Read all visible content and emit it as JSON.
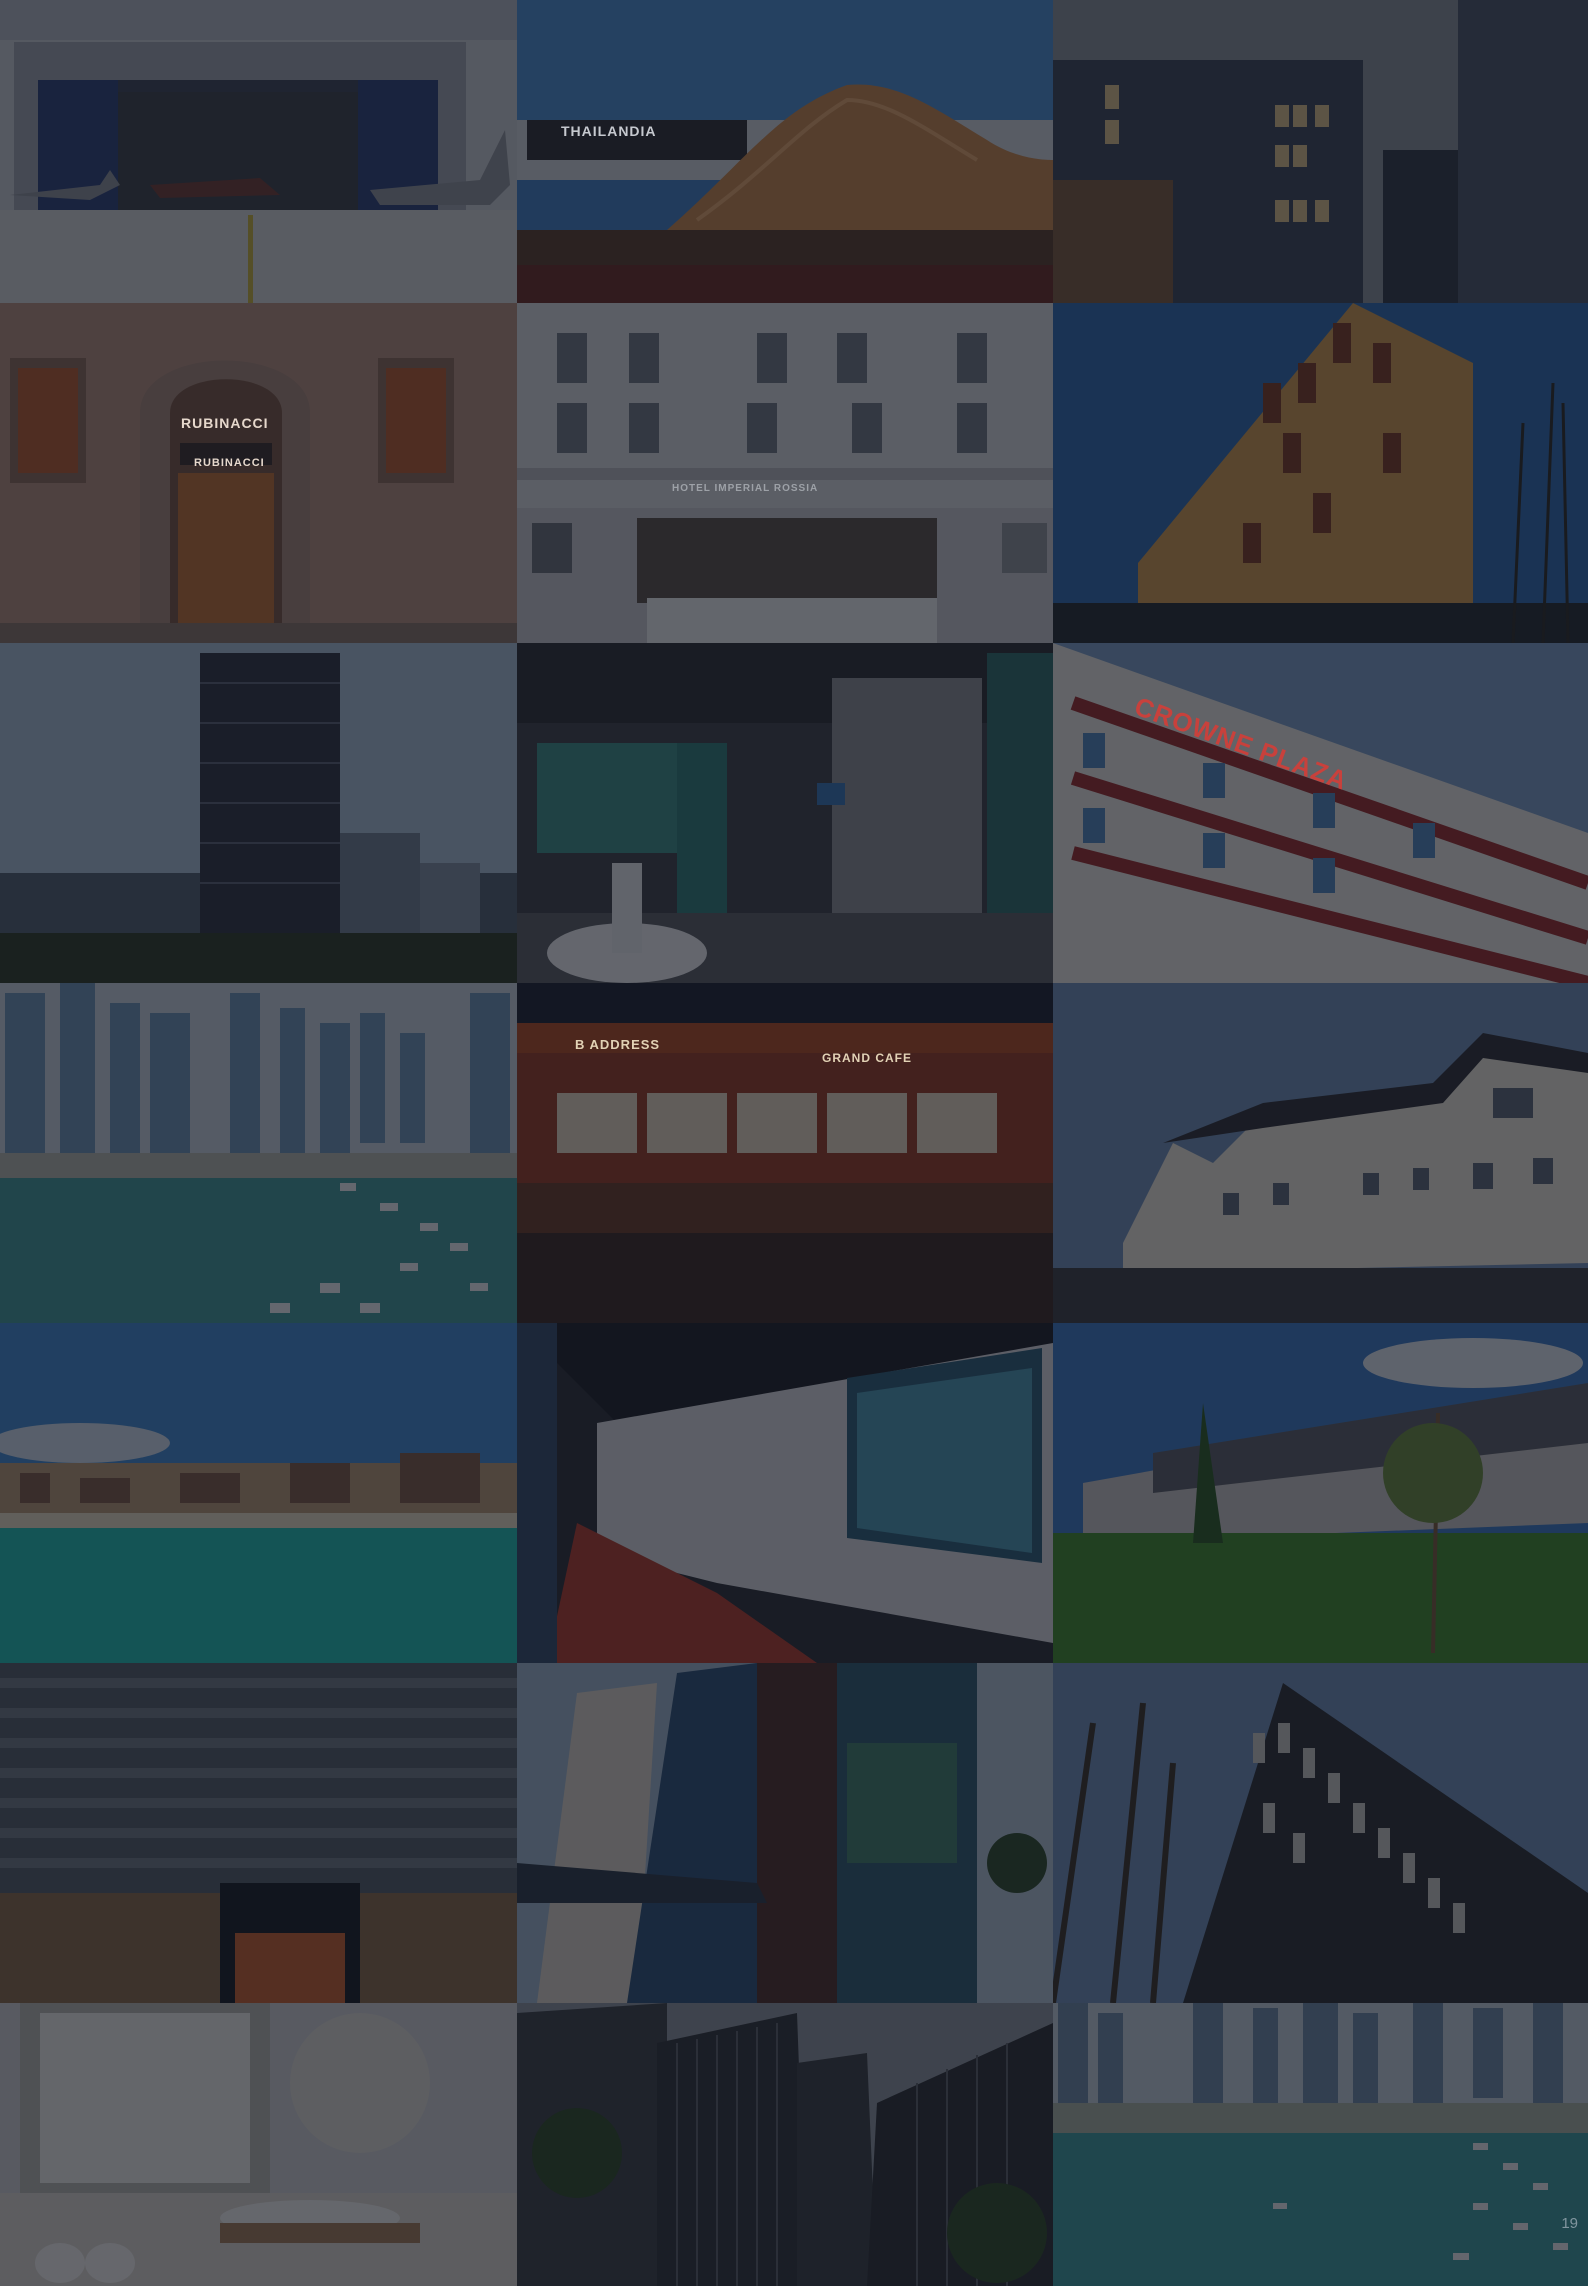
{
  "gallery": {
    "tiles": [
      {
        "id": "tile-1",
        "subject": "aircraft hangar with jets"
      },
      {
        "id": "tile-2",
        "subject": "Thailandia pavilion",
        "sign": "THAILANDIA"
      },
      {
        "id": "tile-3",
        "subject": "modern dark facade buildings"
      },
      {
        "id": "tile-4",
        "subject": "Rubinacci boutique entrance",
        "sign": "RUBINACCI",
        "sign2": "RUBINACCI"
      },
      {
        "id": "tile-5",
        "subject": "white classical hotel facade",
        "sign": "HOTEL IMPERIAL ROSSIA"
      },
      {
        "id": "tile-6",
        "subject": "wood-clad apartment block"
      },
      {
        "id": "tile-7",
        "subject": "patterned skyscraper in city"
      },
      {
        "id": "tile-8",
        "subject": "hotel lobby reception"
      },
      {
        "id": "tile-9",
        "subject": "Crowne Plaza hotel",
        "sign": "CROWNE PLAZA"
      },
      {
        "id": "tile-10",
        "subject": "Dubai marina skyline"
      },
      {
        "id": "tile-11",
        "subject": "shopfront at night",
        "sign": "B ADDRESS",
        "sign2": "GRAND CAFE"
      },
      {
        "id": "tile-12",
        "subject": "white wooden house"
      },
      {
        "id": "tile-13",
        "subject": "beach resort by turquoise sea"
      },
      {
        "id": "tile-14",
        "subject": "corridor with red floor and artwork"
      },
      {
        "id": "tile-15",
        "subject": "lawn with long low building"
      },
      {
        "id": "tile-16",
        "subject": "glass tower entrance"
      },
      {
        "id": "tile-17",
        "subject": "towers with coloured panels"
      },
      {
        "id": "tile-18",
        "subject": "angular dark building with trees"
      },
      {
        "id": "tile-19",
        "subject": "bathroom interior"
      },
      {
        "id": "tile-20",
        "subject": "dark timber slatted buildings"
      },
      {
        "id": "tile-21",
        "subject": "Dubai marina aerial"
      }
    ]
  },
  "pagination": {
    "label": "19"
  }
}
